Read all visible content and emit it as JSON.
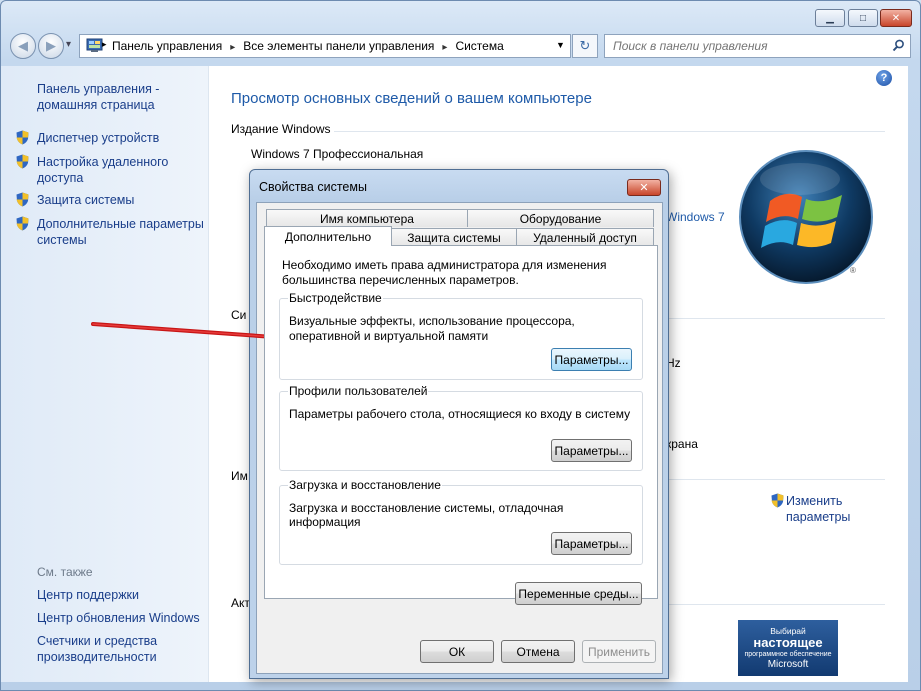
{
  "window": {
    "controls": {
      "minimize": "▁",
      "maximize": "□",
      "close": "✕"
    }
  },
  "navbar": {
    "back": "◀",
    "forward": "▶",
    "history": "▾",
    "breadcrumbs": [
      "Панель управления",
      "Все элементы панели управления",
      "Система"
    ],
    "refresh": "↻",
    "search_placeholder": "Поиск в панели управления"
  },
  "left_pane": {
    "home": "Панель управления - домашняя страница",
    "tasks": [
      "Диспетчер устройств",
      "Настройка удаленного доступа",
      "Защита системы",
      "Дополнительные параметры системы"
    ],
    "see_also_header": "См. также",
    "see_also": [
      "Центр поддержки",
      "Центр обновления Windows",
      "Счетчики и средства производительности"
    ]
  },
  "main": {
    "title": "Просмотр основных сведений о вашем компьютере",
    "edition_header": "Издание Windows",
    "edition": "Windows 7 Профессиональная",
    "partial_right_1": "Windows 7",
    "partial_right_2": "Hz",
    "partial_right_3": "крана",
    "partial_left_1": "Си",
    "partial_left_2": "Им",
    "partial_left_3": "Акт",
    "change_settings": "Изменить параметры",
    "help": "?"
  },
  "dialog": {
    "title": "Свойства системы",
    "close": "✕",
    "tabs_row1": [
      "Имя компьютера",
      "Оборудование"
    ],
    "tabs_row2": [
      "Дополнительно",
      "Защита системы",
      "Удаленный доступ"
    ],
    "active_tab": "Дополнительно",
    "admin_note": "Необходимо иметь права администратора для изменения большинства перечисленных параметров.",
    "groups": [
      {
        "title": "Быстродействие",
        "text": "Визуальные эффекты, использование процессора, оперативной и виртуальной памяти",
        "button": "Параметры..."
      },
      {
        "title": "Профили пользователей",
        "text": "Параметры рабочего стола, относящиеся ко входу в систему",
        "button": "Параметры..."
      },
      {
        "title": "Загрузка и восстановление",
        "text": "Загрузка и восстановление системы, отладочная информация",
        "button": "Параметры..."
      }
    ],
    "env_button": "Переменные среды...",
    "ok": "ОК",
    "cancel": "Отмена",
    "apply": "Применить"
  },
  "ad_badge": {
    "line1": "Выбирай",
    "line2": "настоящее",
    "line3": "программное обеспечение",
    "line4": "Microsoft"
  },
  "colors": {
    "link": "#1a3e8a",
    "title_blue": "#1e5aa8",
    "arrow": "#d61a1a"
  }
}
